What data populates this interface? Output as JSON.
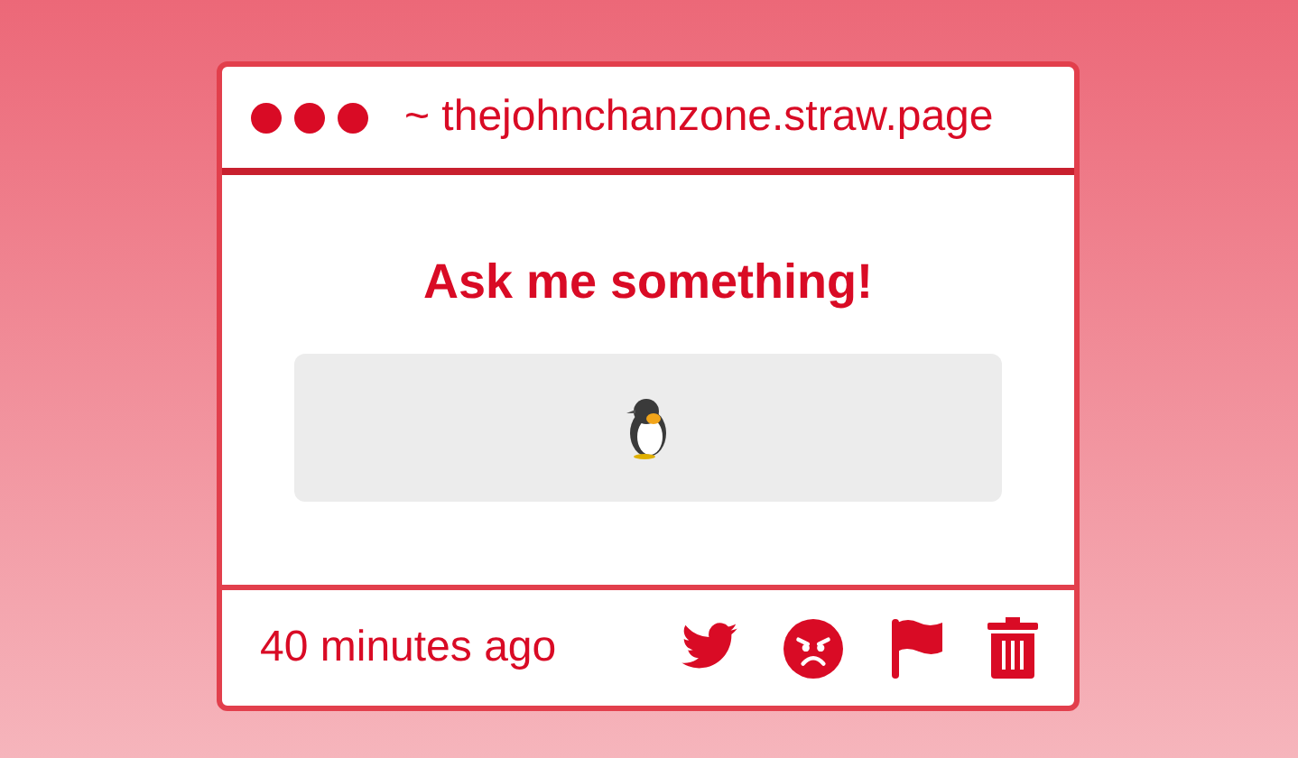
{
  "window": {
    "address": "~ thejohnchanzone.straw.page"
  },
  "heading": "Ask me something!",
  "footer": {
    "time": "40 minutes ago"
  }
}
